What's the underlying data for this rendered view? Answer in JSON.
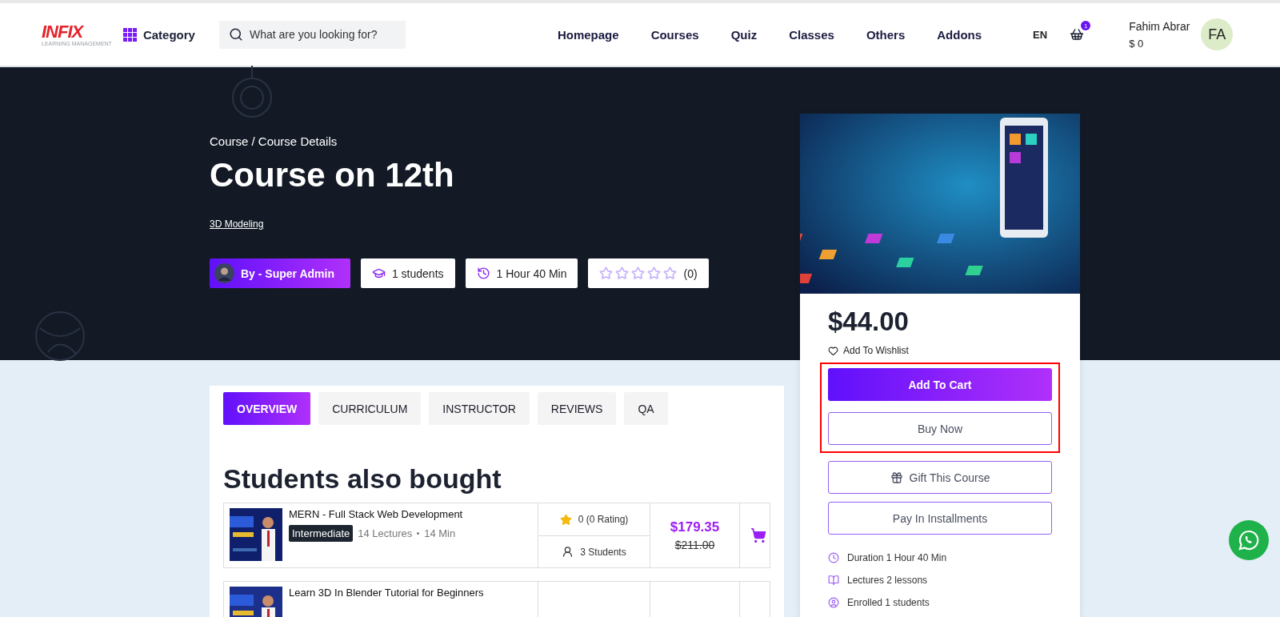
{
  "header": {
    "logo": {
      "text": "INFIX",
      "subtitle": "LEARNING MANAGEMENT"
    },
    "category_label": "Category",
    "search": {
      "placeholder": "What are you looking for?"
    },
    "nav": [
      "Homepage",
      "Courses",
      "Quiz",
      "Classes",
      "Others",
      "Addons"
    ],
    "language": "EN",
    "cart_count": "1",
    "user": {
      "name": "Fahim Abrar",
      "balance": "$ 0",
      "initials": "FA"
    }
  },
  "hero": {
    "breadcrumb": "Course / Course Details",
    "title": "Course on 12th",
    "category": "3D Modeling",
    "instructor": "By - Super Admin",
    "students": "1 students",
    "duration": "1 Hour 40 Min",
    "rating": {
      "stars": 0,
      "count": "(0)"
    }
  },
  "tabs": [
    {
      "label": "OVERVIEW",
      "selected": true
    },
    {
      "label": "CURRICULUM",
      "selected": false
    },
    {
      "label": "INSTRUCTOR",
      "selected": false
    },
    {
      "label": "REVIEWS",
      "selected": false
    },
    {
      "label": "QA",
      "selected": false
    }
  ],
  "section_title": "Students also bought",
  "courses": [
    {
      "title": "MERN - Full Stack Web Development",
      "level": "Intermediate",
      "lectures": "14 Lectures",
      "duration": "14 Min",
      "rating": "0 (0 Rating)",
      "students": "3 Students",
      "price": "$179.35",
      "old_price": "$211.00"
    },
    {
      "title": "Learn 3D In Blender Tutorial for Beginners"
    }
  ],
  "sidebar": {
    "price": "$44.00",
    "wishlist": "Add To Wishlist",
    "buttons": [
      {
        "label": "Add To Cart",
        "kind": "primary",
        "highlighted": true
      },
      {
        "label": "Buy Now",
        "kind": "outline",
        "highlighted": true
      },
      {
        "label": "Gift This Course",
        "kind": "gift",
        "highlighted": false
      },
      {
        "label": "Pay In Installments",
        "kind": "outline",
        "highlighted": false
      }
    ],
    "details": [
      {
        "kind": "duration",
        "text": "Duration 1 Hour 40 Min"
      },
      {
        "kind": "lectures",
        "text": "Lectures 2 lessons"
      },
      {
        "kind": "enrolled",
        "text": "Enrolled 1 students"
      }
    ]
  }
}
